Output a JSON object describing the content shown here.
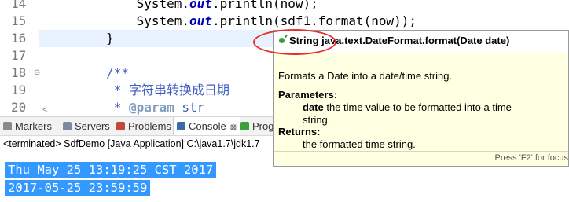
{
  "editor": {
    "lines": [
      {
        "num": "14",
        "marker": "",
        "pre": "            System.",
        "out": "out",
        "post": ".println(now);"
      },
      {
        "num": "15",
        "marker": "",
        "pre": "            System.",
        "out": "out",
        "post": ".println(sdf1.format(now));"
      },
      {
        "num": "16",
        "marker": "",
        "text": "        }"
      },
      {
        "num": "17",
        "marker": "",
        "text": ""
      },
      {
        "num": "18",
        "marker": "⊖",
        "comment": "        /**"
      },
      {
        "num": "19",
        "marker": "",
        "comment": "         * 字符串转换成日期"
      },
      {
        "num": "20",
        "marker": "",
        "comment_pre": "         * ",
        "tag": "@param",
        "comment_post": " str"
      }
    ],
    "scroll_left_arrow": "<"
  },
  "console": {
    "tabs": [
      {
        "label": "Markers",
        "icon": "markers-icon",
        "color": "#8a8a8a"
      },
      {
        "label": "Servers",
        "icon": "servers-icon",
        "color": "#7a8aa0"
      },
      {
        "label": "Problems",
        "icon": "problems-icon",
        "color": "#c04a3a"
      },
      {
        "label": "Console",
        "icon": "console-icon",
        "color": "#3a6aa8",
        "close": "⊠"
      },
      {
        "label": "Prog",
        "icon": "progress-icon",
        "color": "#3aa03a"
      }
    ],
    "status": "<terminated> SdfDemo [Java Application] C:\\java1.7\\jdk1.7",
    "output": [
      "Thu May 25 13:19:25 CST 2017",
      "2017-05-25 23:59:59"
    ]
  },
  "hover": {
    "title": "String java.text.DateFormat.format(Date date)",
    "description": "Formats a Date into a date/time string.",
    "params_heading": "Parameters:",
    "param_name": "date",
    "param_desc_1": " the time value to be formatted into a time",
    "param_desc_2": "string.",
    "returns_heading": "Returns:",
    "returns_desc": "the formatted time string.",
    "footer": "Press 'F2' for focus",
    "icon": "method-icon"
  },
  "colors": {
    "hover_bg": "#ffffe1",
    "selection": "#3399ff",
    "annotation": "#e53030",
    "current_line": "#e8f2fe"
  }
}
